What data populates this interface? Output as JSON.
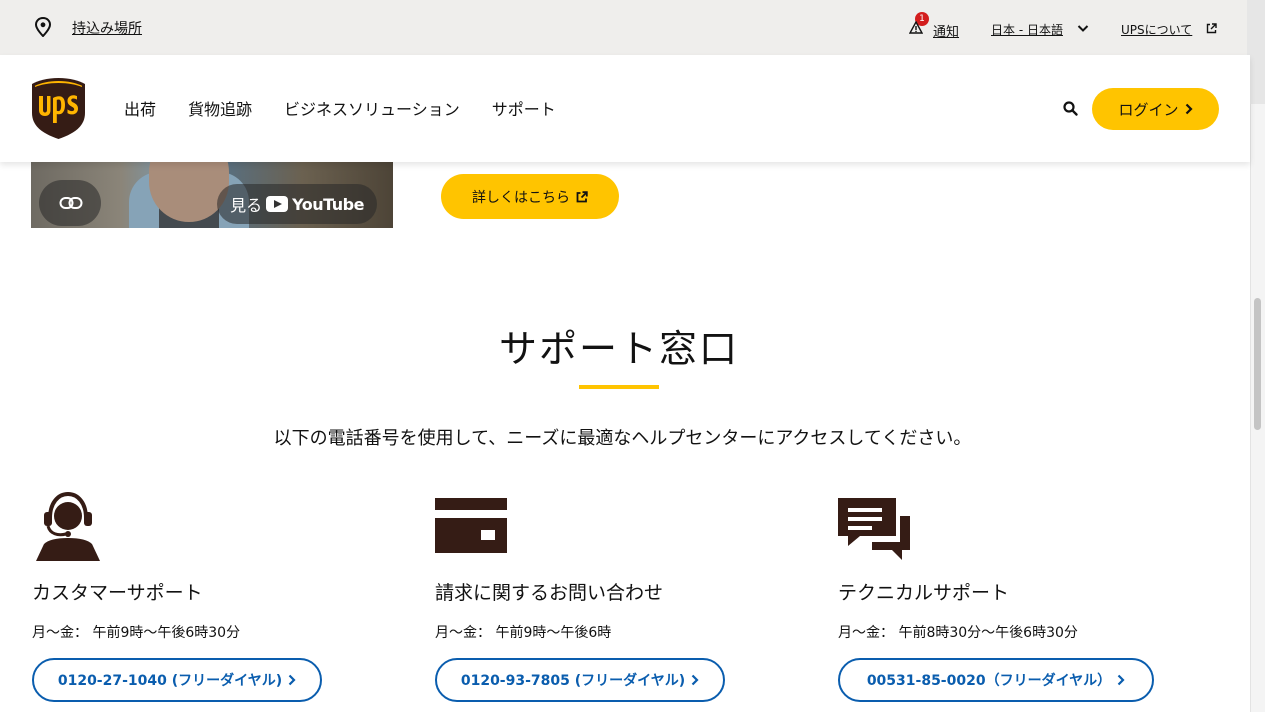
{
  "utility": {
    "location_label": "持込み場所",
    "alert_count": "1",
    "alert_label": "通知",
    "language_label": "日本 - 日本語",
    "about_label": "UPSについて"
  },
  "header": {
    "logo_text": "ups",
    "nav": [
      "出荷",
      "貨物追跡",
      "ビジネスソリューション",
      "サポート"
    ],
    "login_label": "ログイン"
  },
  "promo": {
    "watch_label": "見る",
    "youtube_label": "YouTube",
    "more_label": "詳しくはこちら"
  },
  "support": {
    "title": "サポート窓口",
    "intro": "以下の電話番号を使用して、ニーズに最適なヘルプセンターにアクセスしてください。",
    "cards": [
      {
        "icon": "headset-agent-icon",
        "title": "カスタマーサポート",
        "hours": "月〜金： 午前9時〜午後6時30分",
        "phone": "0120-27-1040 (フリーダイヤル)"
      },
      {
        "icon": "credit-card-icon",
        "title": "請求に関するお問い合わせ",
        "hours": "月〜金： 午前9時〜午後6時",
        "phone": "0120-93-7805 (フリーダイヤル)"
      },
      {
        "icon": "chat-bubbles-icon",
        "title": "テクニカルサポート",
        "hours": "月〜金： 午前8時30分〜午後6時30分",
        "phone": "00531-85-0020（フリーダイヤル）"
      }
    ]
  },
  "colors": {
    "accent_yellow": "#ffc400",
    "link_blue": "#0a5dae",
    "ups_brown": "#351c15",
    "utility_bg": "#efeeec"
  }
}
